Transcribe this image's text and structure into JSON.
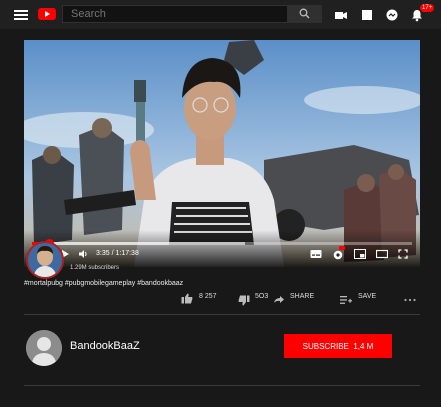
{
  "search": {
    "placeholder": "Search"
  },
  "notifications": {
    "badge": "17+"
  },
  "player": {
    "time_current": "3:35",
    "time_separator": "/",
    "time_total": "1:17:38",
    "progress_fraction": 0.046,
    "buffered_fraction": 0.56
  },
  "channel": {
    "subscribers": "1.29M subscribers",
    "name": "BandookBaaZ"
  },
  "hashtags": "#mortalpubg #pubgmobilegameplay #bandookbaaz",
  "actions": {
    "likes": "8 257",
    "dislikes": "5O3",
    "share": "SHARE",
    "save": "SAVE"
  },
  "subscribe": {
    "label": "SUBSCRIBE",
    "count": "1,4 M"
  },
  "colors": {
    "accent": "#ff0000",
    "background": "#181818",
    "topbar": "#202020"
  }
}
